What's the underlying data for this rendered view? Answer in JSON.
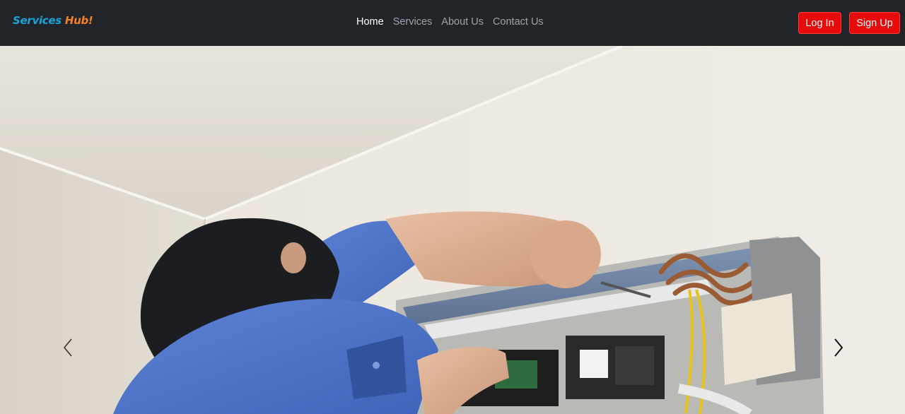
{
  "brand": {
    "part1": "Services",
    "part2": "Hub!"
  },
  "nav": [
    {
      "label": "Home",
      "active": true
    },
    {
      "label": "Services",
      "active": false
    },
    {
      "label": "About Us",
      "active": false
    },
    {
      "label": "Contact Us",
      "active": false
    }
  ],
  "auth": {
    "login_label": "Log In",
    "signup_label": "Sign Up"
  },
  "carousel": {
    "prev_icon": "chevron-left-icon",
    "next_icon": "chevron-right-icon",
    "slide_description_icon": "technician-ac-repair-photo"
  },
  "colors": {
    "navbar_bg": "#212529",
    "brand_blue": "#1aa3d9",
    "brand_orange": "#f4812a",
    "button_red": "#e60a0a",
    "nav_active": "#ffffff",
    "nav_inactive": "#9fa4a9"
  }
}
